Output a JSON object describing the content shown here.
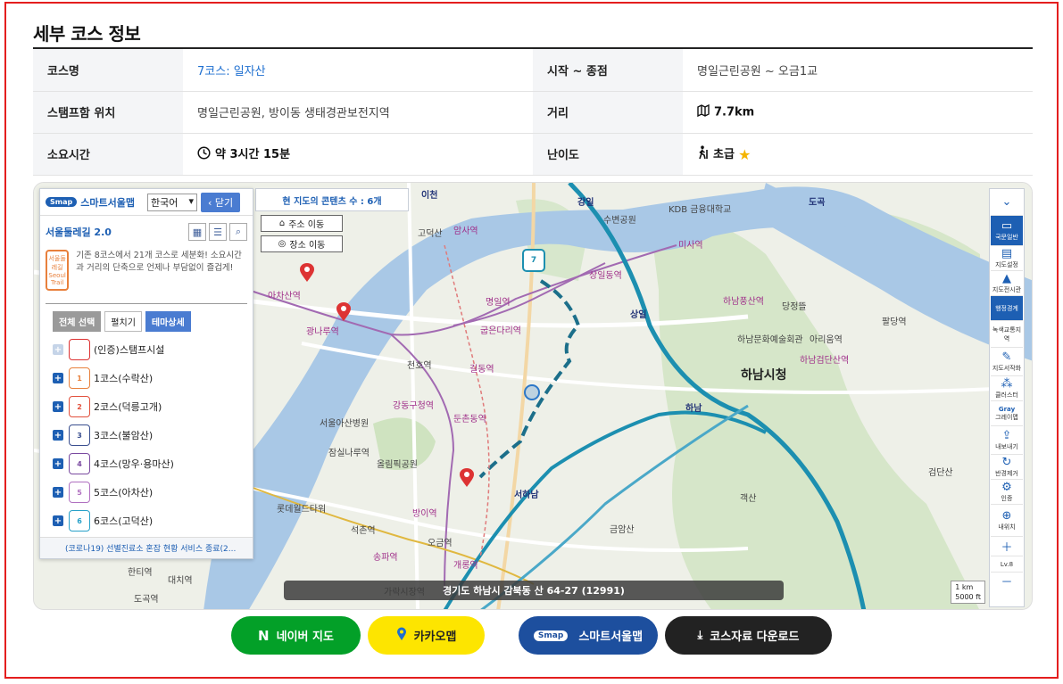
{
  "section_title": "세부 코스 정보",
  "info": {
    "course_name_label": "코스명",
    "course_name_value": "7코스: 일자산",
    "start_end_label": "시작 ~ 종점",
    "start_end_value": "명일근린공원 ~ 오금1교",
    "stamp_label": "스탬프함 위치",
    "stamp_value": "명일근린공원, 방이동 생태경관보전지역",
    "distance_label": "거리",
    "distance_value": "7.7km",
    "time_label": "소요시간",
    "time_value": "약 3시간 15분",
    "difficulty_label": "난이도",
    "difficulty_value": "초급"
  },
  "map": {
    "panel": {
      "brand": "스마트서울맵",
      "smap_logo": "Smap",
      "language": "한국어",
      "close": "닫기",
      "subtitle": "서울둘레길 2.0",
      "logo_text": "서울둘레길 Seoul Trail",
      "intro": "기존 8코스에서 21개 코스로 세분화! 소요시간과 거리의 단축으로 언제나 부담없이 즐겁게!",
      "chip_all": "전체 선택",
      "chip_expand": "펼치기",
      "chip_theme": "테마상세",
      "courses": [
        {
          "num": "",
          "label": "(인증)스탬프시설",
          "color": "#d33"
        },
        {
          "num": "1",
          "label": "1코스(수락산)",
          "color": "#e8803c"
        },
        {
          "num": "2",
          "label": "2코스(덕릉고개)",
          "color": "#e2503c"
        },
        {
          "num": "3",
          "label": "3코스(불암산)",
          "color": "#3a4f8f"
        },
        {
          "num": "4",
          "label": "4코스(망우·용마산)",
          "color": "#7a4aa0"
        },
        {
          "num": "5",
          "label": "5코스(아차산)",
          "color": "#b070c0"
        },
        {
          "num": "6",
          "label": "6코스(고덕산)",
          "color": "#27a0c8"
        }
      ],
      "notice": "(코로나19) 선별진료소 혼잡 현황 서비스 종료(2..."
    },
    "content_count": "현 지도의 콘텐츠 수 : 6개",
    "addr_button": "주소 이동",
    "place_button": "장소 이동",
    "address": "경기도 하남시 감북동 산 64-27 (12991)",
    "scale_km": "1 km",
    "scale_ft": "5000 ft",
    "zoom_level": "Lv.8",
    "tools": {
      "basemap": "국문일반",
      "map_settings": "지도설정",
      "time_series": "지도전시관",
      "admin": "행정경계",
      "traffic": "녹색교통지역",
      "measure": "지도서작화",
      "cluster": "클러스터",
      "gray": "Gray",
      "gray_sub": "그레이맵",
      "export": "내보내기",
      "reset": "반경제거",
      "print": "인증",
      "my_location": "내위치"
    },
    "labels": [
      {
        "t": "아차산역",
        "c": "pink"
      },
      {
        "t": "광나루역",
        "c": "pink"
      },
      {
        "t": "암사역",
        "c": "pink"
      },
      {
        "t": "명일역",
        "c": "pink"
      },
      {
        "t": "굽은다리역",
        "c": "pink"
      },
      {
        "t": "천호역",
        "c": ""
      },
      {
        "t": "길동역",
        "c": "pink"
      },
      {
        "t": "강동구청역",
        "c": "pink"
      },
      {
        "t": "둔촌동역",
        "c": "pink"
      },
      {
        "t": "올림픽공원",
        "c": ""
      },
      {
        "t": "잠실나루역",
        "c": ""
      },
      {
        "t": "롯데월드타워",
        "c": ""
      },
      {
        "t": "석촌역",
        "c": ""
      },
      {
        "t": "송파역",
        "c": "pink"
      },
      {
        "t": "방이역",
        "c": "pink"
      },
      {
        "t": "오금역",
        "c": ""
      },
      {
        "t": "개롱역",
        "c": "pink"
      },
      {
        "t": "가락시장역",
        "c": ""
      },
      {
        "t": "도곡역",
        "c": ""
      },
      {
        "t": "대치역",
        "c": ""
      },
      {
        "t": "한티역",
        "c": ""
      },
      {
        "t": "하남시청",
        "c": "big"
      },
      {
        "t": "하남풍산역",
        "c": "pink"
      },
      {
        "t": "미사역",
        "c": "pink"
      },
      {
        "t": "하남검단산역",
        "c": "pink"
      },
      {
        "t": "상일동역",
        "c": "pink"
      },
      {
        "t": "아리움역",
        "c": ""
      },
      {
        "t": "팔당역",
        "c": ""
      },
      {
        "t": "강일",
        "c": "road"
      },
      {
        "t": "상일",
        "c": "road"
      },
      {
        "t": "하남",
        "c": "road"
      },
      {
        "t": "서하남",
        "c": "road"
      },
      {
        "t": "이천",
        "c": "road"
      },
      {
        "t": "도곡",
        "c": "road"
      },
      {
        "t": "검단산",
        "c": ""
      },
      {
        "t": "객산",
        "c": ""
      },
      {
        "t": "금암산",
        "c": ""
      },
      {
        "t": "당정뜰",
        "c": ""
      },
      {
        "t": "하남문화예술회관",
        "c": ""
      },
      {
        "t": "서울아산병원",
        "c": ""
      },
      {
        "t": "고덕산",
        "c": ""
      },
      {
        "t": "수변공원",
        "c": ""
      },
      {
        "t": "KDB 금융대학교",
        "c": ""
      }
    ]
  },
  "buttons": {
    "naver": "네이버 지도",
    "kakao": "카카오맵",
    "smap": "스마트서울맵",
    "download": "코스자료 다운로드"
  },
  "colors": {
    "accent_blue": "#1d5fb3",
    "naver_green": "#03a028",
    "kakao_yellow": "#fde500",
    "frame_red": "#e41e1e"
  }
}
